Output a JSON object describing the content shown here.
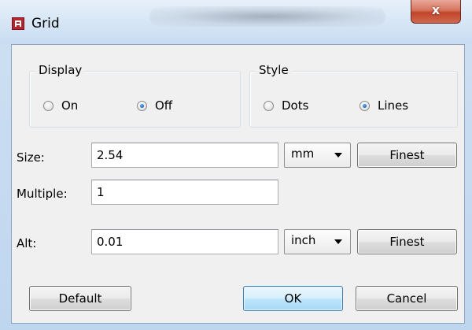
{
  "window": {
    "title": "Grid",
    "icon": "grid-app-icon",
    "close_glyph": "x"
  },
  "display": {
    "label": "Display",
    "options": [
      {
        "label": "On",
        "checked": false
      },
      {
        "label": "Off",
        "checked": true
      }
    ]
  },
  "style": {
    "label": "Style",
    "options": [
      {
        "label": "Dots",
        "checked": false
      },
      {
        "label": "Lines",
        "checked": true
      }
    ]
  },
  "size": {
    "label": "Size:",
    "value": "2.54",
    "unit": "mm",
    "button": "Finest"
  },
  "multiple": {
    "label": "Multiple:",
    "value": "1"
  },
  "alt": {
    "label": "Alt:",
    "value": "0.01",
    "unit": "inch",
    "button": "Finest"
  },
  "buttons": {
    "default": "Default",
    "ok": "OK",
    "cancel": "Cancel"
  },
  "colors": {
    "accent": "#3c7fb1",
    "close": "#c0452c",
    "radio_dot": "#1d64b8"
  }
}
